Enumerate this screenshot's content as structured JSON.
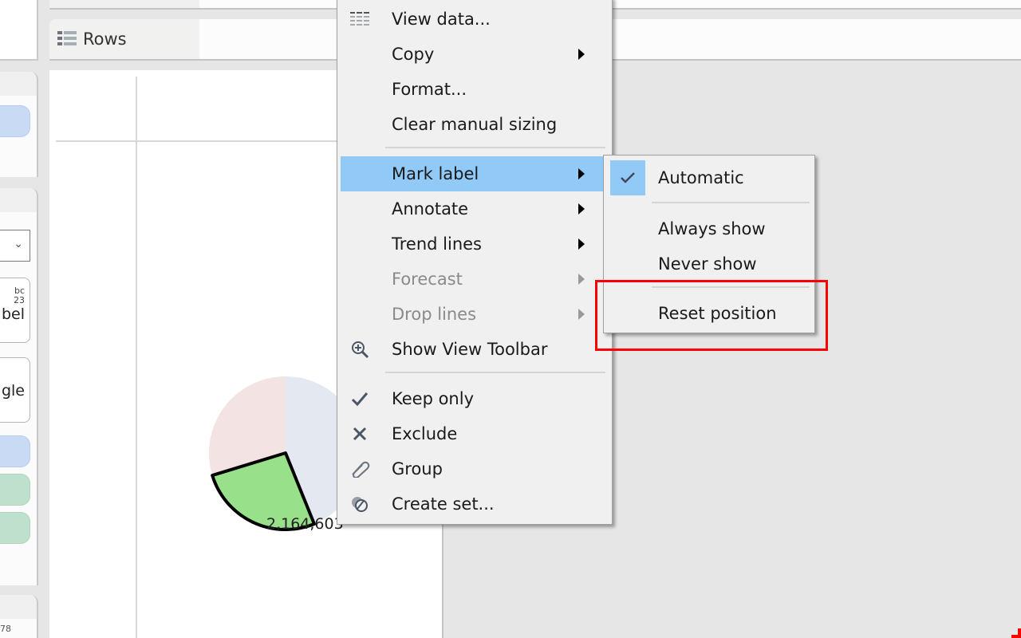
{
  "shelves": {
    "rows_label": "Rows",
    "rows_icon": "list-icon"
  },
  "left_panel": {
    "marks_type_partial": "gle",
    "label_button_partial": "bel",
    "label_button_icon_text": "bc\n23",
    "bottom_partial_text": "78"
  },
  "chart_data": {
    "type": "pie",
    "slices": [
      {
        "name": "slice-blue",
        "color": "#e4e9f1",
        "start_deg": 0,
        "end_deg": 158,
        "selected": false
      },
      {
        "name": "slice-green",
        "color": "#98e089",
        "start_deg": 158,
        "end_deg": 253,
        "selected": true,
        "label": "2,164,603"
      },
      {
        "name": "slice-pink",
        "color": "#f3e3e3",
        "start_deg": 253,
        "end_deg": 360,
        "selected": false
      }
    ],
    "selected_label": "2,164,603"
  },
  "context_menu": {
    "items": [
      {
        "label": "View data...",
        "icon": "view-data-icon",
        "submenu": false,
        "disabled": false
      },
      {
        "label": "Copy",
        "icon": "",
        "submenu": true,
        "disabled": false
      },
      {
        "label": "Format...",
        "icon": "",
        "submenu": false,
        "disabled": false
      },
      {
        "label": "Clear manual sizing",
        "icon": "",
        "submenu": false,
        "disabled": false
      },
      {
        "label": "Mark label",
        "icon": "",
        "submenu": true,
        "disabled": false,
        "highlighted": true
      },
      {
        "label": "Annotate",
        "icon": "",
        "submenu": true,
        "disabled": false
      },
      {
        "label": "Trend lines",
        "icon": "",
        "submenu": true,
        "disabled": false
      },
      {
        "label": "Forecast",
        "icon": "",
        "submenu": true,
        "disabled": true
      },
      {
        "label": "Drop lines",
        "icon": "",
        "submenu": true,
        "disabled": true
      },
      {
        "label": "Show View Toolbar",
        "icon": "zoom-in-icon",
        "submenu": false,
        "disabled": false
      },
      {
        "label": "Keep only",
        "icon": "check-icon",
        "submenu": false,
        "disabled": false
      },
      {
        "label": "Exclude",
        "icon": "x-icon",
        "submenu": false,
        "disabled": false
      },
      {
        "label": "Group",
        "icon": "paperclip-icon",
        "submenu": false,
        "disabled": false
      },
      {
        "label": "Create set...",
        "icon": "set-icon",
        "submenu": false,
        "disabled": false
      }
    ]
  },
  "mark_label_submenu": {
    "items": [
      {
        "label": "Automatic",
        "checked": true
      },
      {
        "label": "Always show",
        "checked": false
      },
      {
        "label": "Never show",
        "checked": false
      },
      {
        "label": "Reset position",
        "checked": false,
        "annotated": true
      }
    ]
  },
  "colors": {
    "highlight": "#91c9f7",
    "annotation": "#ff0000"
  }
}
